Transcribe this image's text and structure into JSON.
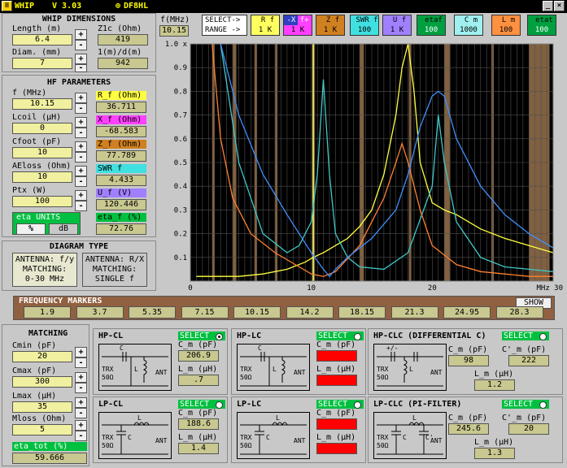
{
  "title": {
    "app": "WHIP",
    "version": "V 3.03",
    "author": "DF8HL"
  },
  "whip_dim": {
    "header": "WHIP DIMENSIONS",
    "length_label": "Length (m)",
    "length": "6.4",
    "z1c_label": "Z1c (Ohm)",
    "z1c": "419",
    "diam_label": "Diam. (mm)",
    "diam": "7",
    "ld_label": "1(m)/d(m)",
    "ld": "942"
  },
  "hf": {
    "header": "HF PARAMETERS",
    "f_label": "f (MHz)",
    "f": "10.15",
    "lcoil_label": "Lcoil (µH)",
    "lcoil": "0",
    "cfoot_label": "Cfoot (pF)",
    "cfoot": "10",
    "aeloss_label": "AEloss (Ohm)",
    "aeloss": "10",
    "ptx_label": "Ptx (W)",
    "ptx": "100",
    "rf_label": "R_f (Ohm)",
    "rf": "36.711",
    "xf_label": "X_f (Ohm)",
    "xf": "-68.583",
    "zf_label": "Z_f (Ohm)",
    "zf": "77.789",
    "swr_label": "SWR f",
    "swr": "4.433",
    "uf_label": "U_f (V)",
    "uf": "120.446",
    "eta_label": "eta_f (%)",
    "eta": "72.76",
    "eta_units": "eta UNITS",
    "pct": "%",
    "db": "dB"
  },
  "diagram_type": {
    "header": "DIAGRAM TYPE",
    "left": [
      "ANTENNA: f/y",
      "MATCHING:",
      "0-30 MHz"
    ],
    "right": [
      "ANTENNA: R/X",
      "MATCHING:",
      "SINGLE f"
    ]
  },
  "top": {
    "fmhz_label": "f(MHz)",
    "fmhz": "10.15",
    "select": "SELECT->",
    "range": "RANGE ->",
    "buttons": [
      {
        "top": "R f",
        "bot": "1 K",
        "color": "#ffff60"
      },
      {
        "top": "-X f+",
        "bot": "1 K",
        "color": "#ff40ff"
      },
      {
        "top": "Z f",
        "bot": "1 K",
        "color": "#d08020"
      },
      {
        "top": "SWR f",
        "bot": "100",
        "color": "#40e0e0"
      },
      {
        "top": "U f",
        "bot": "1 K",
        "color": "#a080ff"
      },
      {
        "top": "etaf",
        "bot": "100",
        "color": "#00a040"
      },
      {
        "top": "C m",
        "bot": "1000",
        "color": "#a0f0f0"
      },
      {
        "top": "L m",
        "bot": "100",
        "color": "#ff9040"
      },
      {
        "top": "etat",
        "bot": "100",
        "color": "#00a040"
      }
    ]
  },
  "chart_data": {
    "type": "line",
    "xlabel": "MHz 30",
    "xlim": [
      0,
      30
    ],
    "ylim": [
      0,
      1.0
    ],
    "x_ticks": [
      "0",
      "10",
      "20"
    ],
    "y_ticks": [
      "0.1",
      "0.2",
      "0.3",
      "0.4",
      "0.5",
      "0.6",
      "0.7",
      "0.8",
      "0.9",
      "1.0 x"
    ],
    "marker_line": 10.15,
    "series": [
      {
        "color": "#ffff40",
        "x": [
          0.5,
          2,
          4,
          6,
          8,
          9.5,
          10.15,
          11,
          12,
          13,
          14,
          15,
          16,
          17,
          17.5,
          18,
          18.5,
          19,
          20,
          21,
          22,
          24,
          26,
          28,
          30
        ],
        "y": [
          0.02,
          0.02,
          0.02,
          0.03,
          0.05,
          0.08,
          0.1,
          0.12,
          0.15,
          0.18,
          0.23,
          0.3,
          0.45,
          0.7,
          0.9,
          1.0,
          0.8,
          0.5,
          0.33,
          0.3,
          0.28,
          0.22,
          0.18,
          0.15,
          0.12
        ]
      },
      {
        "color": "#40c8c8",
        "x": [
          2.5,
          4,
          6,
          8,
          9,
          10,
          10.5,
          11,
          11.5,
          12,
          13,
          14,
          16,
          18,
          20,
          20.5,
          21,
          22,
          24,
          26,
          28,
          30
        ],
        "y": [
          1.0,
          0.5,
          0.2,
          0.12,
          0.15,
          0.25,
          0.45,
          0.85,
          0.45,
          0.2,
          0.1,
          0.06,
          0.05,
          0.12,
          0.4,
          0.7,
          0.5,
          0.25,
          0.1,
          0.06,
          0.05,
          0.04
        ]
      },
      {
        "color": "#ff8030",
        "x": [
          1.8,
          2.5,
          3.5,
          5,
          7,
          9,
          10,
          11,
          12,
          14,
          16,
          17,
          17.5,
          18,
          19,
          20,
          22,
          24,
          26,
          28,
          30
        ],
        "y": [
          1.0,
          0.6,
          0.35,
          0.2,
          0.12,
          0.06,
          0.03,
          0.02,
          0.04,
          0.15,
          0.35,
          0.5,
          0.58,
          0.5,
          0.3,
          0.15,
          0.07,
          0.04,
          0.03,
          0.02,
          0.02
        ]
      },
      {
        "color": "#4090ff",
        "x": [
          2.5,
          4,
          6,
          8,
          10,
          11,
          11.5,
          12,
          13,
          15,
          17,
          18,
          19,
          20,
          20.5,
          21,
          22,
          24,
          26,
          28,
          30
        ],
        "y": [
          1.0,
          0.7,
          0.45,
          0.28,
          0.12,
          0.05,
          0.02,
          0.05,
          0.1,
          0.18,
          0.3,
          0.45,
          0.65,
          0.78,
          0.8,
          0.78,
          0.6,
          0.4,
          0.28,
          0.2,
          0.14
        ]
      }
    ]
  },
  "markers": {
    "header": "FREQUENCY MARKERS",
    "show": "SHOW",
    "values": [
      "1.9",
      "3.7",
      "5.35",
      "7.15",
      "10.15",
      "14.2",
      "18.15",
      "21.3",
      "24.95",
      "28.3"
    ]
  },
  "matching": {
    "header": "MATCHING",
    "cmin_label": "Cmin (pF)",
    "cmin": "20",
    "cmax_label": "Cmax (pF)",
    "cmax": "300",
    "lmax_label": "Lmax (µH)",
    "lmax": "35",
    "mloss_label": "Mloss (Ohm)",
    "mloss": "5",
    "eta_tot_label": "eta_tot (%)",
    "eta_tot": "59.666"
  },
  "networks": [
    {
      "title": "HP-CL",
      "select": "SELECT",
      "c_label": "C_m (pF)",
      "c": "206.9",
      "l_label": "L_m (µH)",
      "l": ".7",
      "trx": "TRX",
      "ohm": "50Ω",
      "ant": "ANT",
      "cl": "C",
      "ll": "L"
    },
    {
      "title": "HP-LC",
      "select": "SELECT",
      "c_label": "C_m (pF)",
      "c": "",
      "l_label": "L_m (µH)",
      "l": "",
      "trx": "TRX",
      "ohm": "50Ω",
      "ant": "ANT",
      "cl": "C",
      "ll": "L"
    },
    {
      "title": "HP-CLC (DIFFERENTIAL C)",
      "select": "SELECT",
      "c_label": "C_m (pF)",
      "c": "98",
      "c2_label": "C'_m (pF)",
      "c2": "222",
      "l_label": "L_m (µH)",
      "l": "1.2",
      "trx": "TRX",
      "ohm": "50Ω",
      "ant": "ANT",
      "cl": "C",
      "ll": "L",
      "pm": "+/-"
    },
    {
      "title": "LP-CL",
      "select": "SELECT",
      "c_label": "C_m (pF)",
      "c": "188.6",
      "l_label": "L_m (µH)",
      "l": "1.4",
      "trx": "TRX",
      "ohm": "50Ω",
      "ant": "ANT",
      "cl": "C",
      "ll": "L"
    },
    {
      "title": "LP-LC",
      "select": "SELECT",
      "c_label": "C_m (pF)",
      "c": "",
      "l_label": "L_m (µH)",
      "l": "",
      "trx": "TRX",
      "ohm": "50Ω",
      "ant": "ANT",
      "cl": "C",
      "ll": "L"
    },
    {
      "title": "LP-CLC (PI-FILTER)",
      "select": "SELECT",
      "c_label": "C_m (pF)",
      "c": "245.6",
      "c2_label": "C'_m (pF)",
      "c2": "20",
      "l_label": "L_m (µH)",
      "l": "1.3",
      "trx": "TRX",
      "ohm": "50Ω",
      "ant": "ANT",
      "cl": "C",
      "ll": "L",
      "c2l": "C'"
    }
  ]
}
